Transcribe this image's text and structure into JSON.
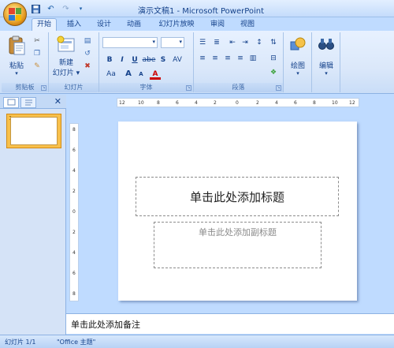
{
  "window": {
    "title": "演示文稿1 - Microsoft PowerPoint"
  },
  "tabs": [
    {
      "label": "开始",
      "active": true
    },
    {
      "label": "插入"
    },
    {
      "label": "设计"
    },
    {
      "label": "动画"
    },
    {
      "label": "幻灯片放映"
    },
    {
      "label": "审阅"
    },
    {
      "label": "视图"
    }
  ],
  "ribbon": {
    "clipboard": {
      "label": "剪贴板",
      "paste": "粘贴"
    },
    "slides": {
      "label": "幻灯片",
      "new_slide_line1": "新建",
      "new_slide_line2": "幻灯片 ▾"
    },
    "font": {
      "label": "字体",
      "bold": "B",
      "italic": "I",
      "underline": "U",
      "strike": "abe",
      "shadow": "S",
      "spacing": "AV",
      "case": "Aa",
      "grow": "A",
      "shrink": "A",
      "color": "A"
    },
    "paragraph": {
      "label": "段落"
    },
    "drawing": {
      "label": "绘图"
    },
    "editing": {
      "label": "编辑"
    }
  },
  "slide_pane": {
    "close": "✕",
    "thumb_number": "1"
  },
  "rulers": {
    "h": [
      "12",
      "10",
      "8",
      "6",
      "4",
      "2",
      "0",
      "2",
      "4",
      "6",
      "8",
      "10",
      "12"
    ],
    "v": [
      "8",
      "6",
      "4",
      "2",
      "0",
      "2",
      "4",
      "6",
      "8"
    ]
  },
  "slide": {
    "title_placeholder": "单击此处添加标题",
    "subtitle_placeholder": "单击此处添加副标题"
  },
  "notes": {
    "text": "单击此处添加备注"
  },
  "status": {
    "slide_count": "幻灯片 1/1",
    "theme": "\"Office 主题\""
  },
  "colors": {
    "accent": "#15428b",
    "ribbon_bg": "#dbe8fa",
    "selected_thumb": "#f8c04b"
  }
}
